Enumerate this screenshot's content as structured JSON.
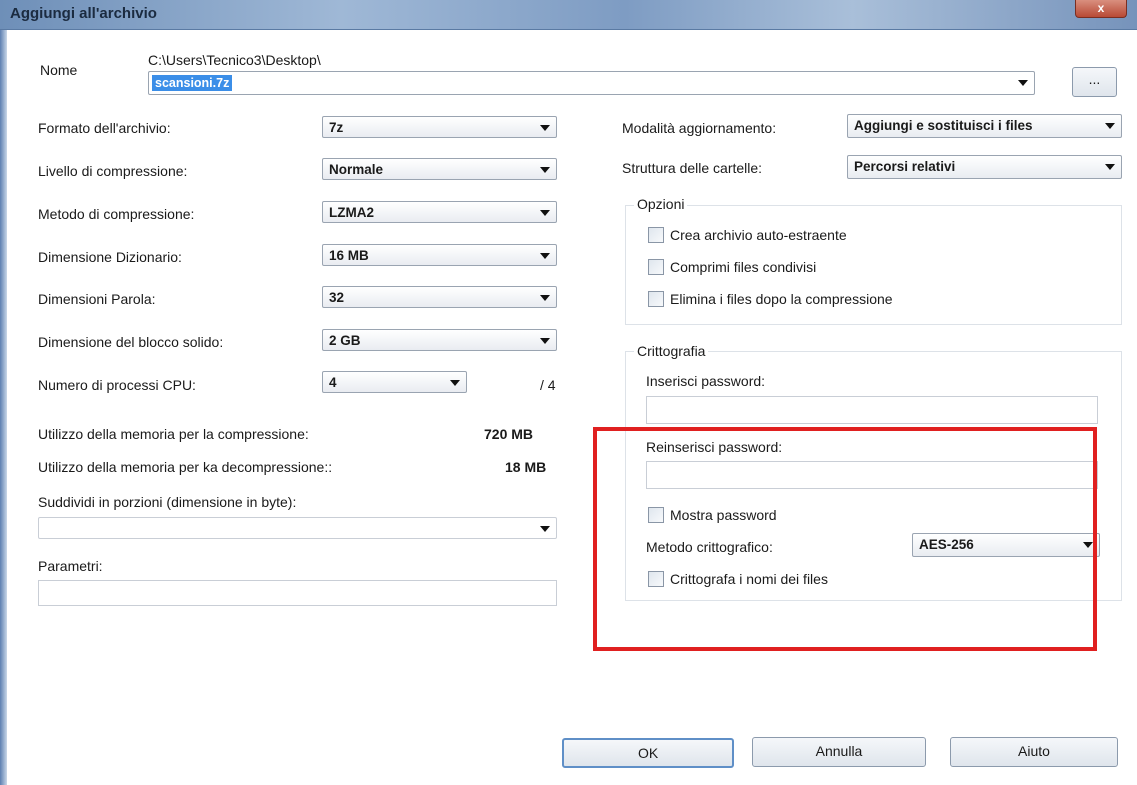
{
  "window": {
    "title": "Aggiungi all'archivio",
    "close_glyph": "x"
  },
  "archive": {
    "name_label": "Nome",
    "path": "C:\\Users\\Tecnico3\\Desktop\\",
    "filename": "scansioni.7z",
    "browse_label": "..."
  },
  "left": {
    "format_label": "Formato dell'archivio:",
    "format_value": "7z",
    "level_label": "Livello di compressione:",
    "level_value": "Normale",
    "method_label": "Metodo di compressione:",
    "method_value": "LZMA2",
    "dict_label": "Dimensione Dizionario:",
    "dict_value": "16 MB",
    "word_label": "Dimensioni Parola:",
    "word_value": "32",
    "solid_label": "Dimensione del blocco solido:",
    "solid_value": "2 GB",
    "cpu_label": "Numero di processi CPU:",
    "cpu_value": "4",
    "cpu_max": "/ 4",
    "mem_comp_label": "Utilizzo della memoria per la compressione:",
    "mem_comp_value": "720 MB",
    "mem_decomp_label": "Utilizzo della memoria per ka decompressione::",
    "mem_decomp_value": "18 MB",
    "split_label": "Suddividi in porzioni (dimensione in byte):",
    "split_value": "",
    "params_label": "Parametri:",
    "params_value": ""
  },
  "right": {
    "update_label": "Modalità aggiornamento:",
    "update_value": "Aggiungi e sostituisci i files",
    "paths_label": "Struttura delle cartelle:",
    "paths_value": "Percorsi relativi",
    "options_title": "Opzioni",
    "opt_sfx": "Crea archivio auto-estraente",
    "opt_shared": "Comprimi files condivisi",
    "opt_delete": "Elimina i files dopo la compressione",
    "crypto_title": "Crittografia",
    "pwd_label": "Inserisci password:",
    "pwd2_label": "Reinserisci password:",
    "show_pwd": "Mostra password",
    "enc_method_label": "Metodo crittografico:",
    "enc_method_value": "AES-256",
    "enc_names": "Crittografa i nomi dei files"
  },
  "buttons": {
    "ok": "OK",
    "cancel": "Annulla",
    "help": "Aiuto"
  },
  "colors": {
    "highlight": "#e02020",
    "selection": "#3b8ee8",
    "title_bar": "#7e9cc3"
  }
}
